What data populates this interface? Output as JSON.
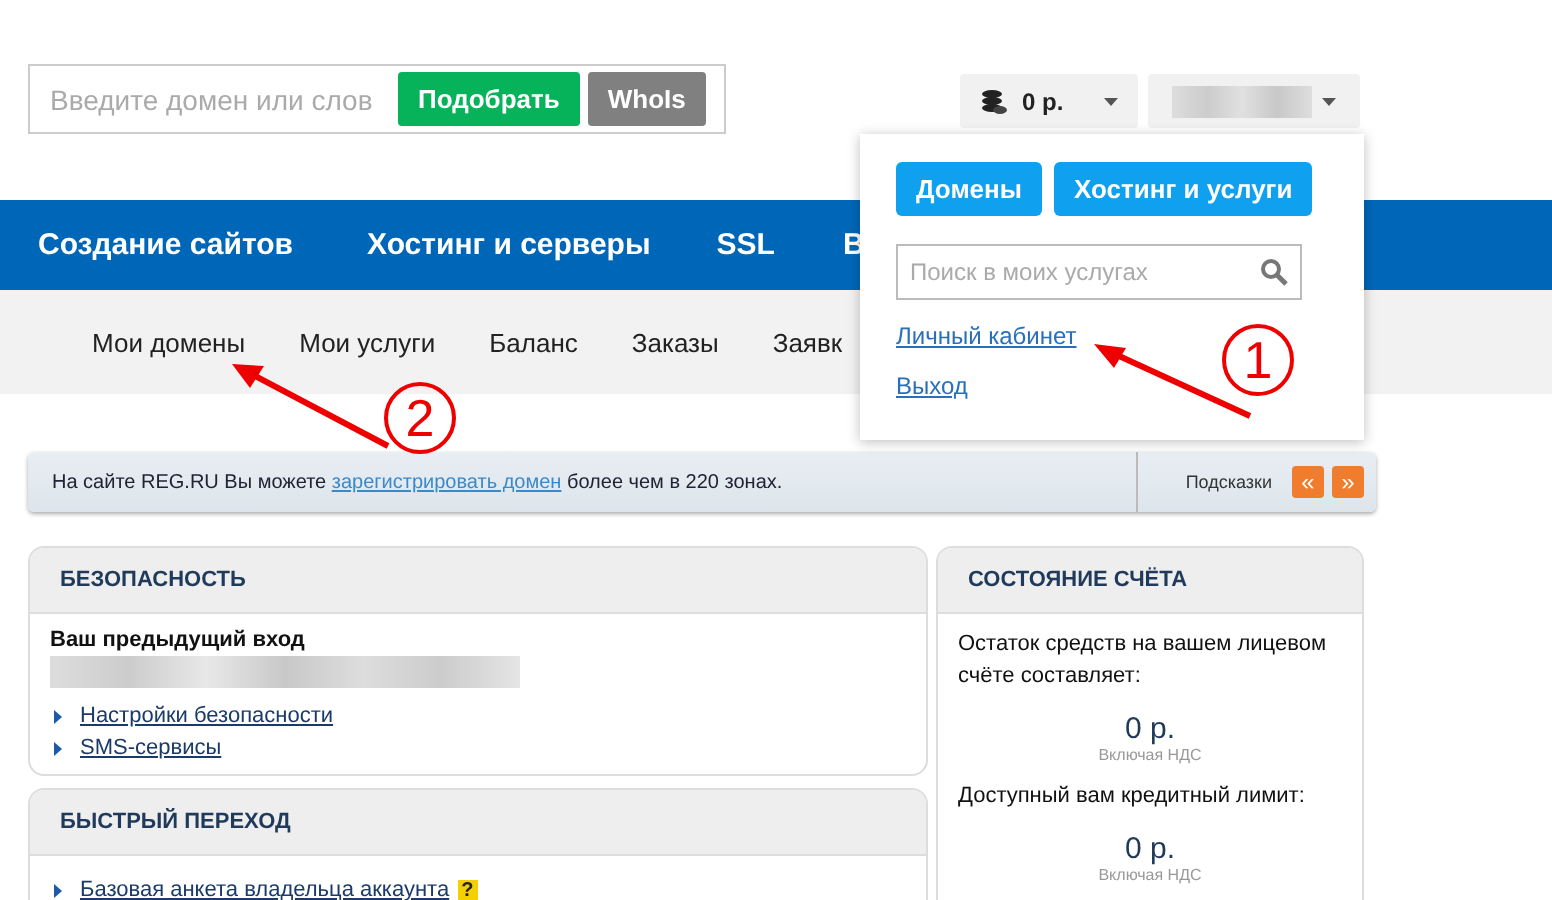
{
  "domain_search": {
    "placeholder": "Введите домен или слов",
    "buttons": [
      {
        "label": "Подобрать",
        "kind": "primary"
      },
      {
        "label": "WhoIs",
        "kind": "secondary"
      }
    ]
  },
  "balance_button": {
    "label": "0 р."
  },
  "main_nav": [
    "Создание сайтов",
    "Хостинг и серверы",
    "SSL",
    "В"
  ],
  "sub_nav": [
    {
      "label": "Мои домены",
      "selected": false
    },
    {
      "label": "Мои услуги",
      "selected": false
    },
    {
      "label": "Баланс",
      "selected": false
    },
    {
      "label": "Заказы",
      "selected": false
    },
    {
      "label": "Заявк",
      "selected": false
    }
  ],
  "dropdown": {
    "buttons": [
      "Домены",
      "Хостинг и услуги"
    ],
    "search_placeholder": "Поиск в моих услугах",
    "links": [
      "Личный кабинет",
      "Выход"
    ]
  },
  "info_bar": {
    "before": "На сайте REG.RU Вы можете ",
    "link": "зарегистрировать домен",
    "after": " более чем в 220 зонах.",
    "hints_label": "Подсказки",
    "prev": "«",
    "next": "»"
  },
  "security": {
    "title": "БЕЗОПАСНОСТЬ",
    "last_login_label": "Ваш предыдущий вход",
    "links": [
      "Настройки безопасности",
      "SMS-сервисы"
    ]
  },
  "quick_nav": {
    "title": "БЫСТРЫЙ ПЕРЕХОД",
    "links": [
      {
        "label": "Базовая анкета владельца аккаунта",
        "help": "?"
      }
    ]
  },
  "account": {
    "title": "СОСТОЯНИЕ СЧЁТА",
    "items": [
      {
        "label": "Остаток средств на вашем лицевом счёте составляет:",
        "amount": "0 р.",
        "note": "Включая НДС"
      },
      {
        "label": "Доступный вам кредитный лимит:",
        "amount": "0 р.",
        "note": "Включая НДС"
      }
    ]
  },
  "annotations": [
    {
      "number": "1"
    },
    {
      "number": "2"
    }
  ]
}
